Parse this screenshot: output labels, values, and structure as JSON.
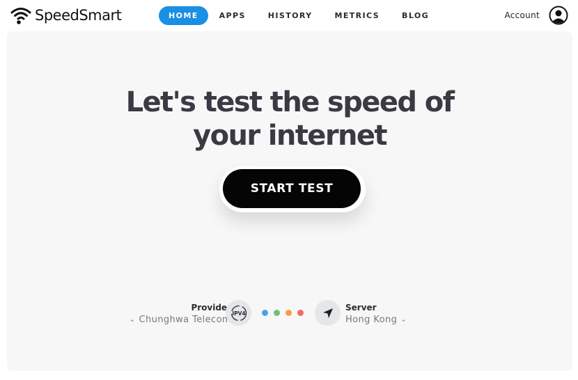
{
  "brand": {
    "name": "SpeedSmart"
  },
  "nav": {
    "items": [
      {
        "label": "HOME",
        "active": true
      },
      {
        "label": "APPS",
        "active": false
      },
      {
        "label": "HISTORY",
        "active": false
      },
      {
        "label": "METRICS",
        "active": false
      },
      {
        "label": "BLOG",
        "active": false
      }
    ]
  },
  "account": {
    "label": "Account"
  },
  "hero": {
    "line1": "Let's test the speed of",
    "line2_prefix": "your ",
    "line2_highlight": "internet",
    "button_label": "START TEST"
  },
  "info": {
    "provider_title": "Provider",
    "provider_value": "Chunghwa Telecom",
    "ip_version": "IPV4",
    "server_title": "Server",
    "server_value": "Hong Kong"
  },
  "colors": {
    "accent": "#1a8fe3",
    "dots": [
      "#4aa3e0",
      "#6cc07a",
      "#f0a04b",
      "#f06a6a"
    ]
  }
}
